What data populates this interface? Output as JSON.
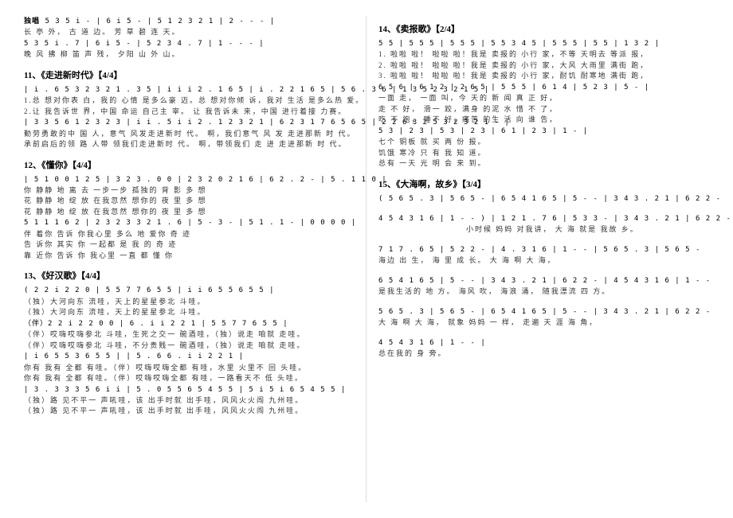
{
  "left": {
    "intro": {
      "label": "独唱",
      "notation1": "5 3 5 i - | 6 i 5 - | 5 1 2 3 2 1 | 2 - - - |",
      "lyric1": "长 亭   外，    古 道    边。   芳 草 碧 连     天。",
      "notation2": "5 3 5 i . 7 | 6 i 5 - | 5 2 3 4 . 7 | 1 - - - |",
      "lyric2": "晚 风     拂 柳 笛 声    残，    夕阳 山   外   山。"
    },
    "song11": {
      "title": "11、《走进新时代》【4/4】",
      "line1_notation": "| i . 6 5 3 2 3 2 1 . 3 5 | i i i 2 . 1 6 5 | i . 2 2 1 6 5 | 5 6 . 3 6 | 1 3 5 2 3 2 1 5 |",
      "line1_lyric1": "1.总 想对你表   白，我的 心情 是多么豪 迈。总 想对你倾    诉，我对 生活 是多么热   爱。",
      "line1_lyric2": "2.让  我告诉世   界，中国 命运  自己主 宰。 让  我告诉未    来，中国  进行着接    力赛。",
      "line2_notation": "| 3 3 5 6 1 2 3 2 3 | i i . 5 i i 2 . 1 2 3 2 1 | 6 2 3 1 7 6 5 6 5 | 2 2 6 3 2 5 3 2 3 2 1 - |",
      "line2_lyric1": "勤劳勇敢的中 国   人，意气 风发走进新时  代。 啊，我们意气 风  发 走进那新  时 代。",
      "line2_lyric2": "承前启后的领 路   人带 领我们走进新时  代。 啊，带领我们 走  进 走进那新  时 代。"
    },
    "song12": {
      "title": "12、《懂你》【4/4】",
      "line1_notation": "| 5 1 0 0 1 2 5 | 3 2 3 . 0 0 | 2 3 2 0 2 1 6 | 6 2 . 2 - | 5 . 1 1 0 |",
      "line1_lyric1": "你   静静 地 离   去    一步一步 孤独的 背 影    多   想",
      "line1_lyric2": "花   静静 地 绽   放    在我忽然 想你的 夜 里    多   想",
      "line1_lyric3": "花   静静 地 绽   放    在我忽然 想你的 夜 里    多   想",
      "line2_notation": "5 1 1 1 6 2 | 2 3 2 3 3 2 1 . 6 | 5 - 3 - | 5 1 . 1 - | 0 0 0 0 |",
      "line2_lyric1": "伴 着你  告诉  你我心里  多么  地  爱你         奇 迹",
      "line2_lyric2": "告 诉你  其实  你 一起都  是   我 的           奇 迹",
      "line2_lyric3": "靠 近你  告诉  你 我心里  一直  都             懂 你"
    },
    "song13": {
      "title": "13、《好汉歌》【4/4】",
      "line1_notation": "( 2 2 i 2 2 0 | 5 5 7 7 6 5 5 | i i 6 5 5 6 5 5 |",
      "line1_lyric1": "（独）大河向东  流哇，天上的星星参北  斗哇。",
      "line1_lyric2": "（独）大河向东  流哇，天上的星星参北  斗哇。",
      "line2_notation": "（伴）2 2 i 2 2 0 0 | 6 . i i 2 2 1 | 5 5 7 7 6 5 5 |",
      "line2_lyric1": "（伴）哎嗨哎嗨参北  斗哇，生死之交一 碗酒哇，（独）说走 咱就  走哇。",
      "line2_lyric2": "（伴）哎嗨哎嗨参北  斗哇，不分贵贱一 碗酒哇，（独）说走 咱就  走哇。",
      "line3_notation": "| i 6 5 5 3 6 5 5 |         | 5 . 6 6 . i i 2 2 1 |",
      "line3_lyric1": "你有 我有 全都  有哇。（伴）哎嗨哎嗨全都  有哇，水里 火里不 回   头哇。",
      "line3_lyric2": "你有 我有 全都  有哇。（伴）哎嗨哎嗨全都  有哇，一路看天不 低   头哇。",
      "line4_notation": "| 3 . 3 3 3 5 6 i i | 5 . 0 5 5 6 5 4 5 5 | 5 i 5 i 6 5 4 5 5 |",
      "line4_lyric1": "（独）路 见不平一  声吼哇，该 出手时就  出手哇，风风火火闯 九州哇。",
      "line4_lyric2": "（独）路 见不平一  声吼哇，该 出手时就  出手哇，风风火火闯 九州哇。"
    }
  },
  "right": {
    "song14": {
      "title": "14、《卖报歌》【2/4】",
      "line1_notation": "5 5 | 5 5 5 | 5 5 5 | 5 5 3 4 5 | 5 5 5 | 5 5 | 1 3 2 |",
      "line1_lyric1": "1. 啦啦 啦！  啦啦 啦！我是 卖报的 小行 家，不等   天明去   等派  报，",
      "line1_lyric2": "2. 啦啦 啦！  啦啦 啦！我是 卖报的 小行 家，大风   大雨里   满街  跑，",
      "line1_lyric3": "3. 啦啦 啦！  啦啦 啦！我是 卖报的 小行 家，耐饥   耐寒地   满街  跑，",
      "line2_notation": "6 5 6 | 6 1 2 | 2 6 5 | 5 5 5 | 6 1 4 | 5 2 3 | 5 - |",
      "line2_lyric1": "一面 走，    一面 叫，今   天的   新   闻 真  正     好，",
      "line2_lyric2": "走 不 好，   滑一 跤，满身  的泥 水  惜 不     了，",
      "line2_lyric3": "吃 不 饱，   睡不 好，痛苦  的生 活  向 谁     告，",
      "line3_notation": "5 3 | 2 3 | 5 3 | 2 3 | 6 1 | 2 3 | 1 - |",
      "line3_lyric1": "七个  铜板   就  买  两   份   报。",
      "line3_lyric2": "饥饿  寒冷   只   有   我   知   道。",
      "line3_lyric3": "总有  一天   光   明   会   来   到。"
    },
    "song15": {
      "title": "15、《大海啊，故乡》【3/4】",
      "line1_notation": "( 5 6 5 . 3 | 5 6 5 - | 6 5 4 1 6 5 | 5 - - | 3 4 3 . 2 1 | 6 2 2 -",
      "line2_notation": "4 5 4 3 1 6 | 1 - - ) | 1 2 1 . 7 6 | 5 3 3 - | 3 4 3 . 2 1 | 6 2 2 -",
      "line2_lyric": "小时候  妈妈 对我讲，  大  海 就是 我故 乡。",
      "line3_notation": "7 1 7 . 6 5 | 5 2 2 - | 4 . 3 1 6 | 1 - - | 5 6 5 . 3 | 5 6 5 -",
      "line3_lyric": "海边       出 生，     海 里  成 长。        大  海   啊 大 海，",
      "line4_notation": "6 5 4 1 6 5 | 5 - - | 3 4 3 . 2 1 | 6 2 2 - | 4 5 4 3 1 6 | 1 - -",
      "line4_lyric": "是我生活的 地    方。    海风 吹，  海浪 涌，   随我漂流 四      方。",
      "line5_notation": "5 6 5 . 3 | 5 6 5 - | 6 5 4 1 6 5 | 5 - - | 3 4 3 . 2 1 | 6 2 2 -",
      "line5_lyric": "大  海   啊 大   海，    就象 妈妈 一    样，     走遍 天   涯  海  角，",
      "line6_notation": "4 5 4 3 1 6 | 1 - - |",
      "line6_lyric": "总在我的 身    旁。"
    }
  }
}
